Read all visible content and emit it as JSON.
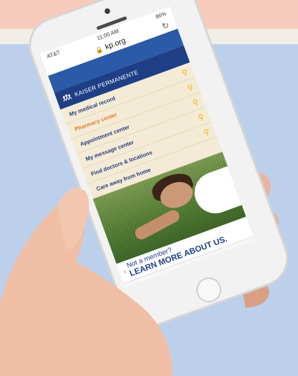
{
  "status": {
    "carrier": "AT&T",
    "time": "11:00 AM",
    "battery": "86%"
  },
  "browser": {
    "url": "kp.org",
    "lock_icon": "lock-icon",
    "reload_icon": "reload-icon"
  },
  "brand": {
    "name": "KAISER PERMANENTE",
    "color": "#1e3f86"
  },
  "menu": {
    "items": [
      {
        "label": "My medical record",
        "active": false
      },
      {
        "label": "Pharmacy center",
        "active": true
      },
      {
        "label": "Appointment center",
        "active": false
      },
      {
        "label": "My message center",
        "active": false
      },
      {
        "label": "Find doctors & locations",
        "active": false
      },
      {
        "label": "Care away from home",
        "active": false
      }
    ],
    "active_color": "#e07b24",
    "key_icon": "key-icon"
  },
  "promo": {
    "line1": "Not a member?",
    "line2": "LEARN MORE ABOUT US."
  },
  "toolbar": {
    "icons": [
      "back-icon",
      "forward-icon",
      "share-icon",
      "bookmarks-icon",
      "tabs-icon"
    ]
  }
}
